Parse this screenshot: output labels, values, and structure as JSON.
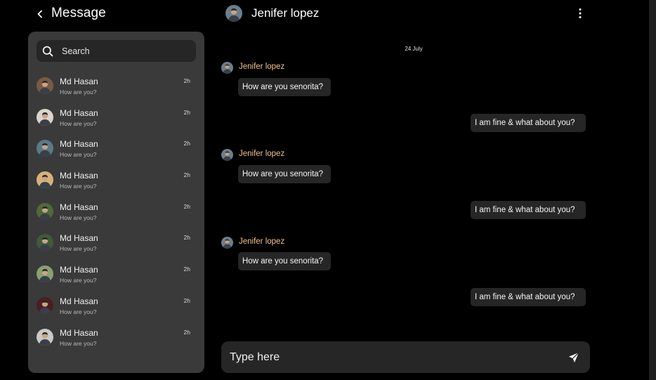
{
  "header": {
    "title": "Message",
    "back_icon": "chevron-left-icon"
  },
  "search": {
    "placeholder": "Search",
    "icon": "search-icon"
  },
  "contacts": [
    {
      "name": "Md Hasan",
      "preview": "How are you?",
      "time": "2h",
      "avatar_color": "#7a5a44"
    },
    {
      "name": "Md Hasan",
      "preview": "How are you?",
      "time": "2h",
      "avatar_color": "#d9d4cc"
    },
    {
      "name": "Md Hasan",
      "preview": "How are you?",
      "time": "2h",
      "avatar_color": "#5a7a8a"
    },
    {
      "name": "Md Hasan",
      "preview": "How are you?",
      "time": "2h",
      "avatar_color": "#d8b07a"
    },
    {
      "name": "Md Hasan",
      "preview": "How are you?",
      "time": "2h",
      "avatar_color": "#4f6a3a"
    },
    {
      "name": "Md Hasan",
      "preview": "How are you?",
      "time": "2h",
      "avatar_color": "#3f5a3a"
    },
    {
      "name": "Md Hasan",
      "preview": "How are you?",
      "time": "2h",
      "avatar_color": "#8aa070"
    },
    {
      "name": "Md Hasan",
      "preview": "How are you?",
      "time": "2h",
      "avatar_color": "#4a1e22"
    },
    {
      "name": "Md Hasan",
      "preview": "How are you?",
      "time": "2h",
      "avatar_color": "#c9c9c9"
    }
  ],
  "chat": {
    "name": "Jenifer lopez",
    "avatar_color": "#6a7f8a",
    "more_icon": "more-vertical-icon",
    "date": "24 July",
    "messages": [
      {
        "direction": "in",
        "sender": "Jenifer lopez",
        "text": "How are you senorita?"
      },
      {
        "direction": "out",
        "text": "I am fine  & what about you?"
      },
      {
        "direction": "in",
        "sender": "Jenifer lopez",
        "text": "How are you senorita?"
      },
      {
        "direction": "out",
        "text": "I am fine  & what about you?"
      },
      {
        "direction": "in",
        "sender": "Jenifer lopez",
        "text": "How are you senorita?"
      },
      {
        "direction": "out",
        "text": "I am fine  & what about you?"
      }
    ]
  },
  "composer": {
    "placeholder": "Type here",
    "send_icon": "send-icon"
  },
  "colors": {
    "background": "#000000",
    "panel": "#3a3a3a",
    "bubble": "#262626",
    "sender_name": "#f2c38a"
  }
}
